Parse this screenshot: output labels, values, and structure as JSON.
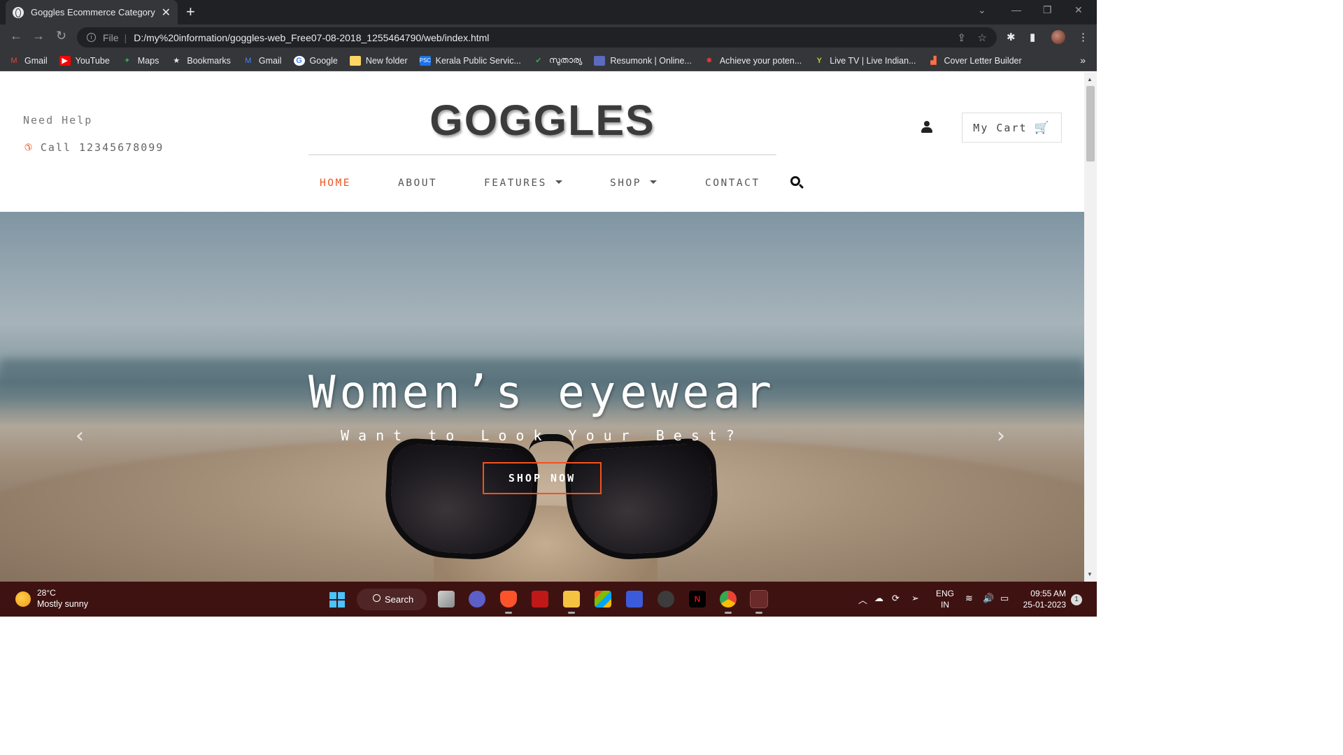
{
  "browser": {
    "tab_title": "Goggles Ecommerce Category Bo",
    "tab_close": "✕",
    "new_tab": "+",
    "url_scheme_label": "File",
    "url": "D:/my%20information/goggles-web_Free07-08-2018_1255464790/web/index.html",
    "bookmarks": [
      {
        "label": "Gmail",
        "icon": "gmail-icon",
        "color": "#ea4335"
      },
      {
        "label": "YouTube",
        "icon": "youtube-icon",
        "color": "#ff0000"
      },
      {
        "label": "Maps",
        "icon": "maps-icon",
        "color": "#34a853"
      },
      {
        "label": "Bookmarks",
        "icon": "star-icon",
        "color": "#e8eaed"
      },
      {
        "label": "Gmail",
        "icon": "gmail-icon",
        "color": "#4285f4"
      },
      {
        "label": "Google",
        "icon": "google-icon",
        "color": "#4285f4"
      },
      {
        "label": "New folder",
        "icon": "folder-icon",
        "color": "#fdd663"
      },
      {
        "label": "Kerala Public Servic...",
        "icon": "psc-icon",
        "color": "#1a73e8"
      },
      {
        "label": "സുതാര്യ",
        "icon": "check-icon",
        "color": "#34a853"
      },
      {
        "label": "Resumonk | Online...",
        "icon": "resumonk-icon",
        "color": "#5c6bc0"
      },
      {
        "label": "Achieve your poten...",
        "icon": "achieve-icon",
        "color": "#e53935"
      },
      {
        "label": "Live TV | Live Indian...",
        "icon": "livetv-icon",
        "color": "#c0ca33"
      },
      {
        "label": "Cover Letter Builder",
        "icon": "cover-letter-icon",
        "color": "#ff7043"
      }
    ],
    "bookmarks_more": "»"
  },
  "site": {
    "help_label": "Need Help",
    "call_label": "Call 12345678099",
    "brand": "GOGGLES",
    "cart_label": "My Cart",
    "menu": {
      "home": "HOME",
      "about": "ABOUT",
      "features": "FEATURES",
      "shop": "SHOP",
      "contact": "CONTACT"
    },
    "accent_color": "#f4511e",
    "hero": {
      "title": "Women’s eyewear",
      "subtitle": "Want to Look Your Best?",
      "button": "SHOP NOW",
      "prev": "‹",
      "next": "›"
    }
  },
  "taskbar": {
    "temperature": "28°C",
    "weather": "Mostly sunny",
    "search_label": "Search",
    "lang_primary": "ENG",
    "lang_secondary": "IN",
    "time": "09:55 AM",
    "date": "25-01-2023",
    "notification_count": "1",
    "apps": [
      "task-view-icon",
      "meet-icon",
      "brave-icon",
      "mcafee-icon",
      "file-explorer-icon",
      "store-icon",
      "vscode-icon",
      "unity-icon",
      "netflix-icon",
      "chrome-icon",
      "snipping-tool-icon"
    ]
  }
}
